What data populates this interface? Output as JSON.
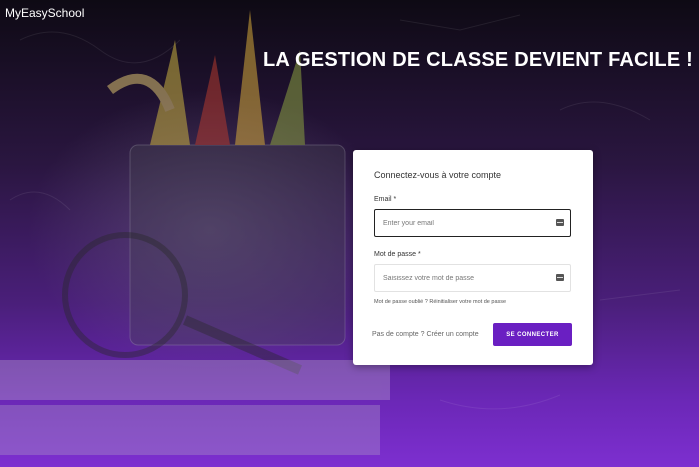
{
  "app": {
    "brand": "MyEasySchool"
  },
  "hero": {
    "headline": "LA GESTION DE CLASSE DEVIENT FACILE !"
  },
  "login": {
    "title": "Connectez-vous à votre compte",
    "email": {
      "label": "Email *",
      "placeholder": "Enter your email",
      "value": ""
    },
    "password": {
      "label": "Mot de passe *",
      "placeholder": "Saisissez votre mot de passe",
      "value": ""
    },
    "forgot_text": "Mot de passe oublié ? Réinitialiser votre mot de passe",
    "signup_text": "Pas de compte ? Créer un compte",
    "submit_label": "SE CONNECTER"
  },
  "colors": {
    "accent": "#6a1fc2",
    "background_bottom": "#7d2fd0"
  }
}
